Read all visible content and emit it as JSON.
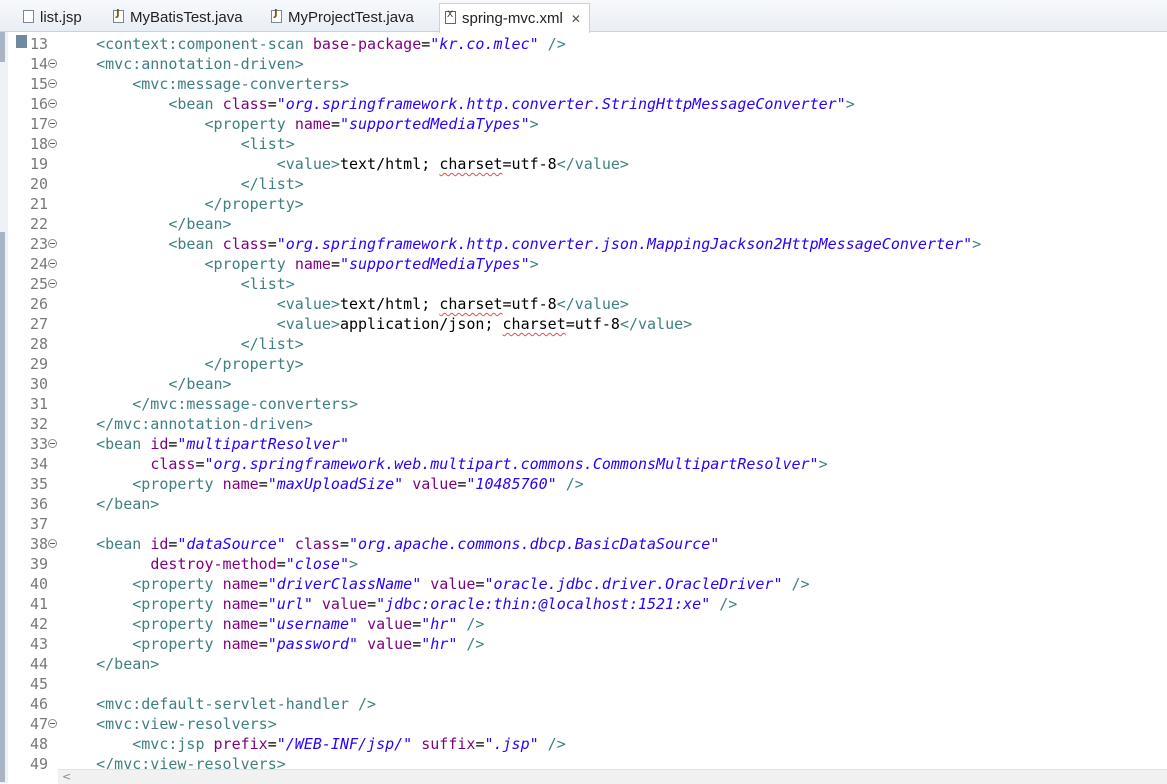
{
  "tabs": [
    {
      "label": "list.jsp",
      "icon": "jsp-file-icon",
      "active": false
    },
    {
      "label": "MyBatisTest.java",
      "icon": "java-file-icon",
      "active": false
    },
    {
      "label": "MyProjectTest.java",
      "icon": "java-file-icon",
      "active": false
    },
    {
      "label": "spring-mvc.xml",
      "icon": "xml-file-icon",
      "active": true,
      "close": "✕"
    }
  ],
  "colors": {
    "tag": "#3f7f7f",
    "attr": "#7f007f",
    "value": "#2a00ff",
    "text": "#000000",
    "line_number": "#787878",
    "spell_error": "#e05050"
  },
  "editor": {
    "lines": [
      {
        "n": "13",
        "fold": false,
        "indent": "    ",
        "segs": [
          [
            "t",
            "<context:component-scan "
          ],
          [
            "a",
            "base-package"
          ],
          [
            "x",
            "="
          ],
          [
            "v",
            "\"kr.co.mlec\""
          ],
          [
            "t",
            " />"
          ]
        ]
      },
      {
        "n": "14",
        "fold": true,
        "indent": "    ",
        "segs": [
          [
            "t",
            "<mvc:annotation-driven>"
          ]
        ]
      },
      {
        "n": "15",
        "fold": true,
        "indent": "        ",
        "segs": [
          [
            "t",
            "<mvc:message-converters>"
          ]
        ]
      },
      {
        "n": "16",
        "fold": true,
        "indent": "            ",
        "segs": [
          [
            "t",
            "<bean "
          ],
          [
            "a",
            "class"
          ],
          [
            "x",
            "="
          ],
          [
            "v",
            "\"org.springframework.http.converter.StringHttpMessageConverter\""
          ],
          [
            "t",
            ">"
          ]
        ]
      },
      {
        "n": "17",
        "fold": true,
        "indent": "                ",
        "segs": [
          [
            "t",
            "<property "
          ],
          [
            "a",
            "name"
          ],
          [
            "x",
            "="
          ],
          [
            "v",
            "\"supportedMediaTypes\""
          ],
          [
            "t",
            ">"
          ]
        ]
      },
      {
        "n": "18",
        "fold": true,
        "indent": "                    ",
        "segs": [
          [
            "t",
            "<list>"
          ]
        ]
      },
      {
        "n": "19",
        "fold": false,
        "indent": "                        ",
        "segs": [
          [
            "t",
            "<value>"
          ],
          [
            "x",
            "text/html; "
          ],
          [
            "u",
            "charset"
          ],
          [
            "x",
            "=utf-8"
          ],
          [
            "t",
            "</value>"
          ]
        ]
      },
      {
        "n": "20",
        "fold": false,
        "indent": "                    ",
        "segs": [
          [
            "t",
            "</list>"
          ]
        ]
      },
      {
        "n": "21",
        "fold": false,
        "indent": "                ",
        "segs": [
          [
            "t",
            "</property>"
          ]
        ]
      },
      {
        "n": "22",
        "fold": false,
        "indent": "            ",
        "segs": [
          [
            "t",
            "</bean>"
          ]
        ]
      },
      {
        "n": "23",
        "fold": true,
        "indent": "            ",
        "segs": [
          [
            "t",
            "<bean "
          ],
          [
            "a",
            "class"
          ],
          [
            "x",
            "="
          ],
          [
            "v",
            "\"org.springframework.http.converter.json.MappingJackson2HttpMessageConverter\""
          ],
          [
            "t",
            ">"
          ]
        ]
      },
      {
        "n": "24",
        "fold": true,
        "indent": "                ",
        "segs": [
          [
            "t",
            "<property "
          ],
          [
            "a",
            "name"
          ],
          [
            "x",
            "="
          ],
          [
            "v",
            "\"supportedMediaTypes\""
          ],
          [
            "t",
            ">"
          ]
        ]
      },
      {
        "n": "25",
        "fold": true,
        "indent": "                    ",
        "segs": [
          [
            "t",
            "<list>"
          ]
        ]
      },
      {
        "n": "26",
        "fold": false,
        "indent": "                        ",
        "segs": [
          [
            "t",
            "<value>"
          ],
          [
            "x",
            "text/html; "
          ],
          [
            "u",
            "charset"
          ],
          [
            "x",
            "=utf-8"
          ],
          [
            "t",
            "</value>"
          ]
        ]
      },
      {
        "n": "27",
        "fold": false,
        "indent": "                        ",
        "segs": [
          [
            "t",
            "<value>"
          ],
          [
            "x",
            "application/json; "
          ],
          [
            "u",
            "charset"
          ],
          [
            "x",
            "=utf-8"
          ],
          [
            "t",
            "</value>"
          ]
        ]
      },
      {
        "n": "28",
        "fold": false,
        "indent": "                    ",
        "segs": [
          [
            "t",
            "</list>"
          ]
        ]
      },
      {
        "n": "29",
        "fold": false,
        "indent": "                ",
        "segs": [
          [
            "t",
            "</property>"
          ]
        ]
      },
      {
        "n": "30",
        "fold": false,
        "indent": "            ",
        "segs": [
          [
            "t",
            "</bean>"
          ]
        ]
      },
      {
        "n": "31",
        "fold": false,
        "indent": "        ",
        "segs": [
          [
            "t",
            "</mvc:message-converters>"
          ]
        ]
      },
      {
        "n": "32",
        "fold": false,
        "indent": "    ",
        "segs": [
          [
            "t",
            "</mvc:annotation-driven>"
          ]
        ]
      },
      {
        "n": "33",
        "fold": true,
        "indent": "    ",
        "segs": [
          [
            "t",
            "<bean "
          ],
          [
            "a",
            "id"
          ],
          [
            "x",
            "="
          ],
          [
            "v",
            "\"multipartResolver\""
          ]
        ]
      },
      {
        "n": "34",
        "fold": false,
        "indent": "          ",
        "segs": [
          [
            "a",
            "class"
          ],
          [
            "x",
            "="
          ],
          [
            "v",
            "\"org.springframework.web.multipart.commons.CommonsMultipartResolver\""
          ],
          [
            "t",
            ">"
          ]
        ]
      },
      {
        "n": "35",
        "fold": false,
        "indent": "        ",
        "segs": [
          [
            "t",
            "<property "
          ],
          [
            "a",
            "name"
          ],
          [
            "x",
            "="
          ],
          [
            "v",
            "\"maxUploadSize\""
          ],
          [
            "x",
            " "
          ],
          [
            "a",
            "value"
          ],
          [
            "x",
            "="
          ],
          [
            "v",
            "\"10485760\""
          ],
          [
            "t",
            " />"
          ]
        ]
      },
      {
        "n": "36",
        "fold": false,
        "indent": "    ",
        "segs": [
          [
            "t",
            "</bean>"
          ]
        ]
      },
      {
        "n": "37",
        "fold": false,
        "indent": "",
        "segs": []
      },
      {
        "n": "38",
        "fold": true,
        "indent": "    ",
        "segs": [
          [
            "t",
            "<bean "
          ],
          [
            "a",
            "id"
          ],
          [
            "x",
            "="
          ],
          [
            "v",
            "\"dataSource\""
          ],
          [
            "x",
            " "
          ],
          [
            "a",
            "class"
          ],
          [
            "x",
            "="
          ],
          [
            "v",
            "\"org.apache.commons.dbcp.BasicDataSource\""
          ]
        ]
      },
      {
        "n": "39",
        "fold": false,
        "indent": "          ",
        "segs": [
          [
            "a",
            "destroy-method"
          ],
          [
            "x",
            "="
          ],
          [
            "v",
            "\"close\""
          ],
          [
            "t",
            ">"
          ]
        ]
      },
      {
        "n": "40",
        "fold": false,
        "indent": "        ",
        "segs": [
          [
            "t",
            "<property "
          ],
          [
            "a",
            "name"
          ],
          [
            "x",
            "="
          ],
          [
            "v",
            "\"driverClassName\""
          ],
          [
            "x",
            " "
          ],
          [
            "a",
            "value"
          ],
          [
            "x",
            "="
          ],
          [
            "v",
            "\"oracle.jdbc.driver.OracleDriver\""
          ],
          [
            "t",
            " />"
          ]
        ]
      },
      {
        "n": "41",
        "fold": false,
        "indent": "        ",
        "segs": [
          [
            "t",
            "<property "
          ],
          [
            "a",
            "name"
          ],
          [
            "x",
            "="
          ],
          [
            "v",
            "\"url\""
          ],
          [
            "x",
            " "
          ],
          [
            "a",
            "value"
          ],
          [
            "x",
            "="
          ],
          [
            "v",
            "\"jdbc:oracle:thin:@localhost:1521:xe\""
          ],
          [
            "t",
            " />"
          ]
        ]
      },
      {
        "n": "42",
        "fold": false,
        "indent": "        ",
        "segs": [
          [
            "t",
            "<property "
          ],
          [
            "a",
            "name"
          ],
          [
            "x",
            "="
          ],
          [
            "v",
            "\"username\""
          ],
          [
            "x",
            " "
          ],
          [
            "a",
            "value"
          ],
          [
            "x",
            "="
          ],
          [
            "v",
            "\"hr\""
          ],
          [
            "t",
            " />"
          ]
        ]
      },
      {
        "n": "43",
        "fold": false,
        "indent": "        ",
        "segs": [
          [
            "t",
            "<property "
          ],
          [
            "a",
            "name"
          ],
          [
            "x",
            "="
          ],
          [
            "v",
            "\"password\""
          ],
          [
            "x",
            " "
          ],
          [
            "a",
            "value"
          ],
          [
            "x",
            "="
          ],
          [
            "v",
            "\"hr\""
          ],
          [
            "t",
            " />"
          ]
        ]
      },
      {
        "n": "44",
        "fold": false,
        "indent": "    ",
        "segs": [
          [
            "t",
            "</bean>"
          ]
        ]
      },
      {
        "n": "45",
        "fold": false,
        "indent": "",
        "segs": []
      },
      {
        "n": "46",
        "fold": false,
        "indent": "    ",
        "segs": [
          [
            "t",
            "<mvc:default-servlet-handler />"
          ]
        ]
      },
      {
        "n": "47",
        "fold": true,
        "indent": "    ",
        "segs": [
          [
            "t",
            "<mvc:view-resolvers>"
          ]
        ]
      },
      {
        "n": "48",
        "fold": false,
        "indent": "        ",
        "segs": [
          [
            "t",
            "<mvc:jsp "
          ],
          [
            "a",
            "prefix"
          ],
          [
            "x",
            "="
          ],
          [
            "v",
            "\"/WEB-INF/jsp/\""
          ],
          [
            "x",
            " "
          ],
          [
            "a",
            "suffix"
          ],
          [
            "x",
            "="
          ],
          [
            "v",
            "\".jsp\""
          ],
          [
            "t",
            " />"
          ]
        ]
      },
      {
        "n": "49",
        "fold": false,
        "indent": "    ",
        "segs": [
          [
            "t",
            "</mvc:view-resolvers>"
          ]
        ]
      }
    ]
  },
  "scrollbar": {
    "left_arrow": "<"
  }
}
